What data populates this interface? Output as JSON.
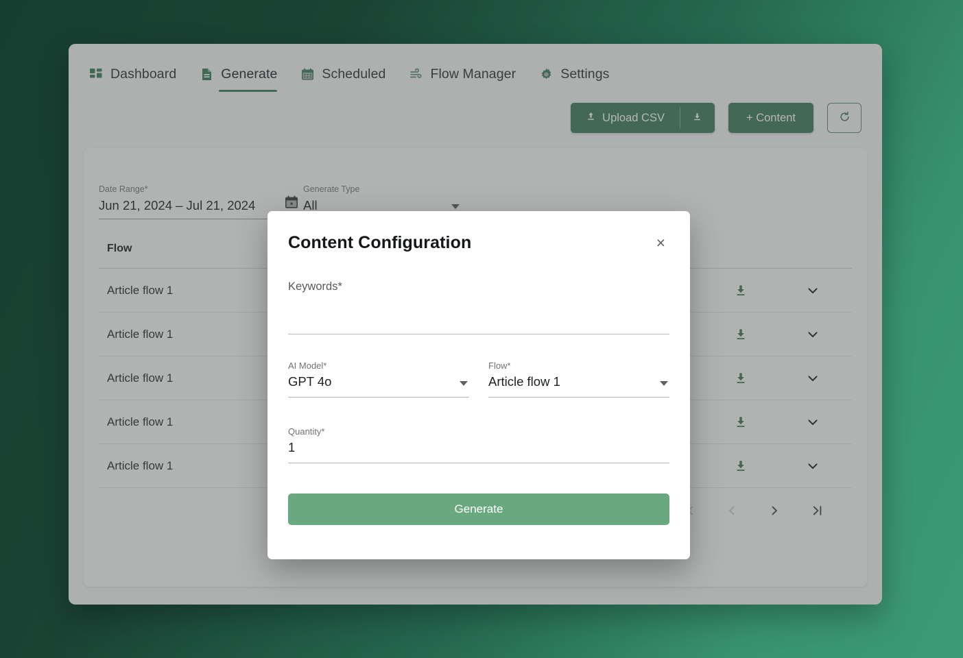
{
  "nav": {
    "items": [
      {
        "label": "Dashboard",
        "icon": "grid-icon",
        "active": false
      },
      {
        "label": "Generate",
        "icon": "document-icon",
        "active": true
      },
      {
        "label": "Scheduled",
        "icon": "calendar-icon",
        "active": false
      },
      {
        "label": "Flow Manager",
        "icon": "flow-icon",
        "active": false
      },
      {
        "label": "Settings",
        "icon": "gear-icon",
        "active": false
      }
    ]
  },
  "toolbar": {
    "upload_csv_label": "Upload CSV",
    "upload_csv_icon": "upload-icon",
    "download_template_icon": "download-icon",
    "add_content_label": "+ Content",
    "refresh_icon": "refresh-icon"
  },
  "filters": {
    "date_range": {
      "label": "Date Range*",
      "value": "Jun 21, 2024  –  Jul 21, 2024",
      "icon": "calendar-icon"
    },
    "generate_type": {
      "label": "Generate Type",
      "value": "All",
      "icon": "chevron-down-icon"
    }
  },
  "table": {
    "columns": [
      "Flow"
    ],
    "rows": [
      {
        "flow": "Article flow 1",
        "download_icon": "download-icon",
        "expand_icon": "chevron-down-icon"
      },
      {
        "flow": "Article flow 1",
        "download_icon": "download-icon",
        "expand_icon": "chevron-down-icon"
      },
      {
        "flow": "Article flow 1",
        "download_icon": "download-icon",
        "expand_icon": "chevron-down-icon"
      },
      {
        "flow": "Article flow 1",
        "download_icon": "download-icon",
        "expand_icon": "chevron-down-icon"
      },
      {
        "flow": "Article flow 1",
        "download_icon": "download-icon",
        "expand_icon": "chevron-down-icon"
      }
    ]
  },
  "pagination": {
    "first_label": "|<",
    "prev_label": "<",
    "next_label": ">",
    "last_label": ">|"
  },
  "modal": {
    "title": "Content Configuration",
    "close_label": "×",
    "keywords": {
      "label": "Keywords*",
      "value": "",
      "placeholder": ""
    },
    "ai_model": {
      "label": "AI Model*",
      "value": "GPT 4o"
    },
    "flow": {
      "label": "Flow*",
      "value": "Article flow 1"
    },
    "quantity": {
      "label": "Quantity*",
      "value": "1"
    },
    "generate_label": "Generate"
  },
  "colors": {
    "brand_green": "#417c5e",
    "accent_green": "#6aa880",
    "bg_gradient_start": "#173f31",
    "bg_gradient_end": "#3d9a76",
    "download_icon": "#3f7f5e"
  }
}
